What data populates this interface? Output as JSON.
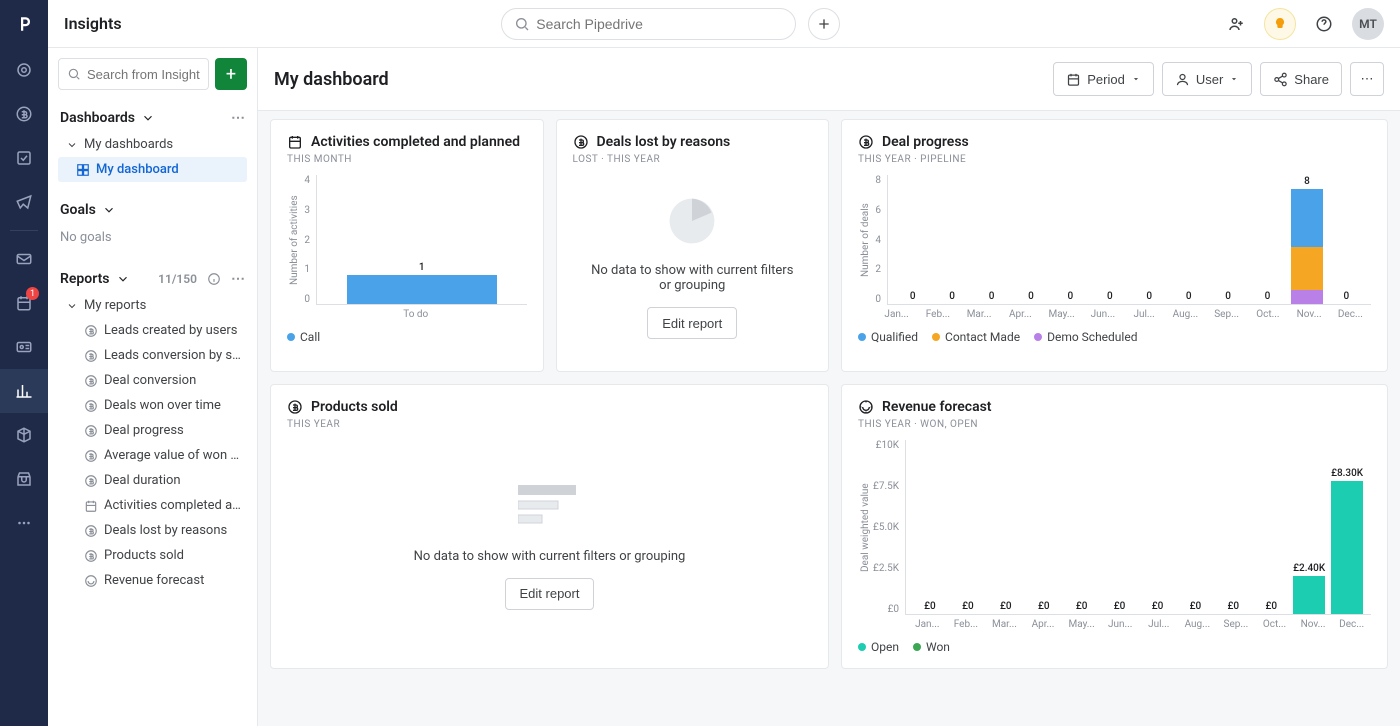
{
  "header": {
    "app_title": "Insights",
    "global_search_placeholder": "Search Pipedrive",
    "avatar_initials": "MT"
  },
  "nav_rail": {
    "badge_count": "1"
  },
  "insights_sidebar": {
    "search_placeholder": "Search from Insights",
    "dashboards_label": "Dashboards",
    "my_dashboards_label": "My dashboards",
    "current_dashboard": "My dashboard",
    "goals_label": "Goals",
    "no_goals": "No goals",
    "reports_label": "Reports",
    "reports_count": "11/150",
    "my_reports_label": "My reports",
    "reports": [
      "Leads created by users",
      "Leads conversion by so...",
      "Deal conversion",
      "Deals won over time",
      "Deal progress",
      "Average value of won d...",
      "Deal duration",
      "Activities completed an...",
      "Deals lost by reasons",
      "Products sold",
      "Revenue forecast"
    ]
  },
  "content_header": {
    "title": "My dashboard",
    "period_label": "Period",
    "user_label": "User",
    "share_label": "Share"
  },
  "cards": {
    "activities": {
      "title": "Activities completed and planned",
      "subtitle": "THIS MONTH",
      "legend": [
        "Call"
      ]
    },
    "deals_lost": {
      "title": "Deals lost by reasons",
      "subtitle": "LOST  ·  THIS YEAR",
      "empty": "No data to show with current filters or grouping",
      "edit": "Edit report"
    },
    "deal_progress": {
      "title": "Deal progress",
      "subtitle": "THIS YEAR  ·  PIPELINE",
      "legend": [
        "Qualified",
        "Contact Made",
        "Demo Scheduled"
      ]
    },
    "products_sold": {
      "title": "Products sold",
      "subtitle": "THIS YEAR",
      "empty": "No data to show with current filters or grouping",
      "edit": "Edit report"
    },
    "revenue": {
      "title": "Revenue forecast",
      "subtitle": "THIS YEAR  ·  WON, OPEN",
      "legend": [
        "Open",
        "Won"
      ]
    }
  },
  "colors": {
    "call_blue": "#4aa3e8",
    "qualified": "#4aa3e8",
    "contact_made": "#f5a623",
    "demo_scheduled": "#b980e8",
    "open_teal": "#1ccdb2",
    "won_green": "#3ba755"
  },
  "chart_data": [
    {
      "id": "activities",
      "type": "bar",
      "title": "Activities completed and planned",
      "ylabel": "Number of activities",
      "xlabel": "",
      "ylim": [
        0,
        4
      ],
      "yticks": [
        4,
        3,
        2,
        1,
        0
      ],
      "categories": [
        "To do"
      ],
      "series": [
        {
          "name": "Call",
          "color": "#4aa3e8",
          "values": [
            1
          ]
        }
      ],
      "value_labels": [
        "1"
      ]
    },
    {
      "id": "deal_progress",
      "type": "stacked-bar",
      "title": "Deal progress",
      "ylabel": "Number of deals",
      "xlabel": "",
      "ylim": [
        0,
        8
      ],
      "yticks": [
        8,
        6,
        4,
        2,
        0
      ],
      "categories": [
        "Jan...",
        "Feb...",
        "Mar...",
        "Apr...",
        "May...",
        "Jun...",
        "Jul...",
        "Aug...",
        "Sep...",
        "Oct...",
        "Nov...",
        "Dec..."
      ],
      "series": [
        {
          "name": "Qualified",
          "color": "#4aa3e8",
          "values": [
            0,
            0,
            0,
            0,
            0,
            0,
            0,
            0,
            0,
            0,
            4,
            0
          ]
        },
        {
          "name": "Contact Made",
          "color": "#f5a623",
          "values": [
            0,
            0,
            0,
            0,
            0,
            0,
            0,
            0,
            0,
            0,
            3,
            0
          ]
        },
        {
          "name": "Demo Scheduled",
          "color": "#b980e8",
          "values": [
            0,
            0,
            0,
            0,
            0,
            0,
            0,
            0,
            0,
            0,
            1,
            0
          ]
        }
      ],
      "totals": [
        0,
        0,
        0,
        0,
        0,
        0,
        0,
        0,
        0,
        0,
        8,
        0
      ]
    },
    {
      "id": "revenue_forecast",
      "type": "bar",
      "title": "Revenue forecast",
      "ylabel": "Deal weighted value",
      "xlabel": "",
      "currency": "GBP",
      "ylim": [
        0,
        10000
      ],
      "yticks_labels": [
        "£10K",
        "£7.5K",
        "£5.0K",
        "£2.5K",
        "£0"
      ],
      "categories": [
        "Jan...",
        "Feb...",
        "Mar...",
        "Apr...",
        "May...",
        "Jun...",
        "Jul...",
        "Aug...",
        "Sep...",
        "Oct...",
        "Nov...",
        "Dec..."
      ],
      "series": [
        {
          "name": "Open",
          "color": "#1ccdb2",
          "values": [
            0,
            0,
            0,
            0,
            0,
            0,
            0,
            0,
            0,
            0,
            2400,
            8300
          ]
        },
        {
          "name": "Won",
          "color": "#3ba755",
          "values": [
            0,
            0,
            0,
            0,
            0,
            0,
            0,
            0,
            0,
            0,
            0,
            0
          ]
        }
      ],
      "value_labels": [
        "£0",
        "£0",
        "£0",
        "£0",
        "£0",
        "£0",
        "£0",
        "£0",
        "£0",
        "£0",
        "£2.40K",
        "£8.30K"
      ]
    }
  ]
}
